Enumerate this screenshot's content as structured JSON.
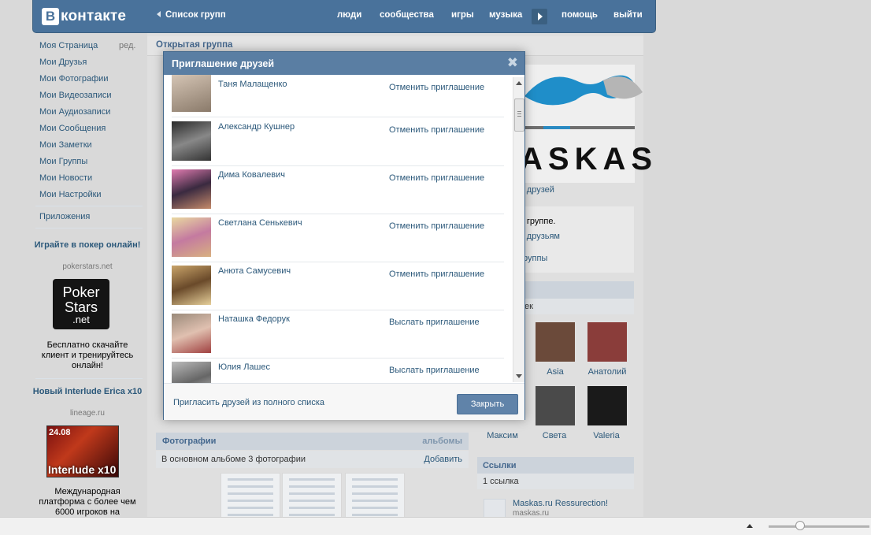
{
  "header": {
    "logo_text": "контакте",
    "logo_letter": "В",
    "back_link": "Список групп",
    "nav": [
      "люди",
      "сообщества",
      "игры",
      "музыка",
      "помощь",
      "выйти"
    ]
  },
  "left_menu": {
    "items": [
      "Моя Страница",
      "Мои Друзья",
      "Мои Фотографии",
      "Мои Видеозаписи",
      "Мои Аудиозаписи",
      "Мои Сообщения",
      "Мои Заметки",
      "Мои Группы",
      "Мои Новости",
      "Мои Настройки"
    ],
    "edit_label": "ред.",
    "apps_label": "Приложения"
  },
  "ads": [
    {
      "title": "Играйте в покер онлайн!",
      "domain": "pokerstars.net",
      "logo": [
        "Poker",
        "Stars",
        ".net"
      ],
      "text": "Бесплатно скачайте клиент и тренируйтесь онлайн!"
    },
    {
      "title": "Новый Interlude Erica x10",
      "domain": "lineage.ru",
      "image_date": "24.08",
      "image_tag": "Interlude x10",
      "text": "Международная платформа с более чем 6000 игроков на"
    }
  ],
  "main": {
    "title": "Открытая группа",
    "photos_header": "Фотографии",
    "photos_albums": "альбомы",
    "photos_subtitle": "В основном альбоме 3 фотографии",
    "photos_add": "Добавить"
  },
  "right": {
    "logo_word": "ASKAS",
    "link_friends": "ь друзей",
    "in_group": "в группе.",
    "link_invite": "ь друзьям",
    "link_group": "группы",
    "members_partial_count": "ек",
    "members_row1": [
      "Asia",
      "Анатолий"
    ],
    "members_row2": [
      "Максим",
      "Света",
      "Valeria"
    ],
    "links_header": "Ссылки",
    "links_count": "1 ссылка",
    "link_title": "Maskas.ru Ressurection!",
    "link_domain": "maskas.ru"
  },
  "modal": {
    "title": "Приглашение друзей",
    "close_glyph": "✖",
    "friends": [
      {
        "name": "Таня Малащенко",
        "action": "Отменить приглашение"
      },
      {
        "name": "Александр Кушнер",
        "action": "Отменить приглашение"
      },
      {
        "name": "Дима Ковалевич",
        "action": "Отменить приглашение"
      },
      {
        "name": "Светлана Сенькевич",
        "action": "Отменить приглашение"
      },
      {
        "name": "Анюта Самусевич",
        "action": "Отменить приглашение"
      },
      {
        "name": "Наташка Федорук",
        "action": "Выслать приглашение"
      },
      {
        "name": "Юлия Лашес",
        "action": "Выслать приглашение"
      }
    ],
    "invite_all": "Пригласить друзей из полного списка",
    "close_button": "Закрыть"
  },
  "colors": {
    "header_bg": "#49729b",
    "link": "#2b587a",
    "modal_header": "#5a7ea3",
    "button": "#6083a9"
  }
}
